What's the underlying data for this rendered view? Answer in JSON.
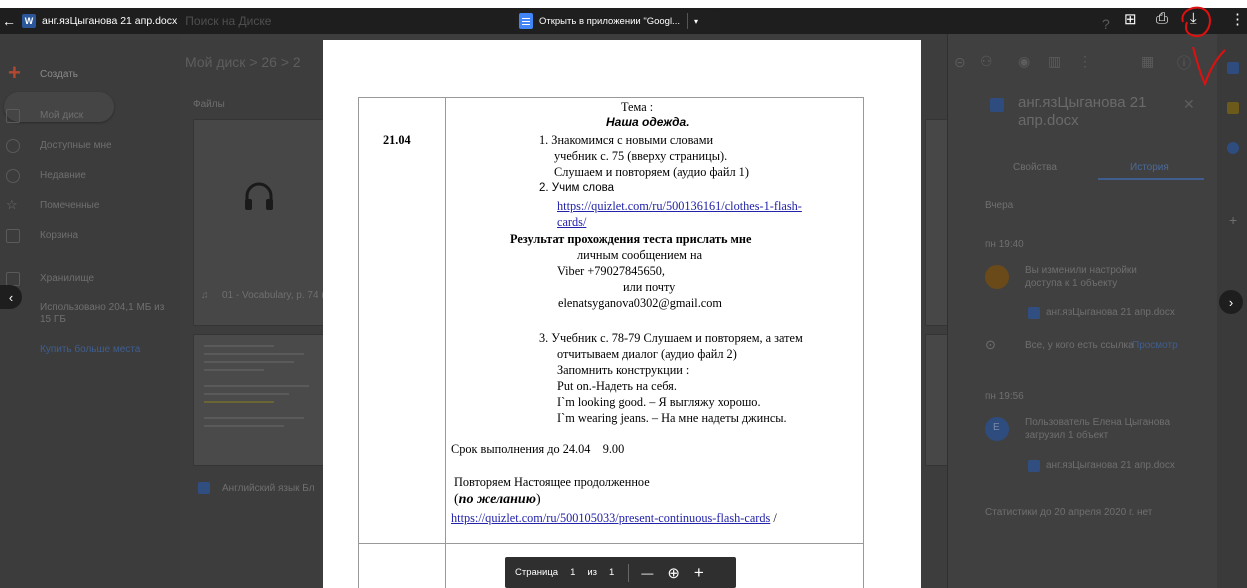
{
  "viewer": {
    "file_name": "анг.язЦыганова 21 апр.docx",
    "word_badge": "W",
    "search_placeholder": "Поиск на Диске",
    "open_button_label": "Открыть в приложении \"Googl...",
    "open_caret": "▾"
  },
  "drive_background": {
    "create_label": "Создать",
    "breadcrumb": "Мой диск > 26 > 2",
    "files_heading": "Файлы",
    "sidebar_items": [
      "Мой диск",
      "Доступные мне",
      "Недавние",
      "Помеченные",
      "Корзина"
    ],
    "storage_label": "Хранилище",
    "storage_usage": "Использовано 204,1 МБ из 15 ГБ",
    "buy_storage": "Купить больше места",
    "file_card_1": "01 - Vocabulary, p. 74 (",
    "file_card_2": "Английский язык Бл",
    "details": {
      "title": "анг.язЦыганова 21 апр.docx",
      "tabs": [
        "Свойства",
        "История"
      ],
      "yesterday": "Вчера",
      "time_1": "пн 19:40",
      "entry_1_text": "Вы изменили настройки доступа к 1 объекту",
      "entry_1_file": "анг.язЦыганова 21 апр.docx",
      "entry_1_access": "Все, у кого есть ссылка",
      "entry_1_access_role": "Просмотр",
      "time_2": "пн 19:56",
      "entry_2_text": "Пользователь Елена Цыганова загрузил 1 объект",
      "entry_2_file": "анг.язЦыганова 21 апр.docx",
      "footer": "Статистики до 20 апреля 2020 г. нет",
      "avatar_letter": "Е"
    }
  },
  "document": {
    "date": "21.04",
    "topic_label": "Тема :",
    "topic_title": "Наша одежда.",
    "item1_line1": "1.  Знакомимся с новыми словами",
    "item1_line2": "учебник с. 75 (вверху страницы).",
    "item1_line3": "Слушаем и повторяем (аудио файл 1)",
    "item2_line1": "2.  Учим слова",
    "item2_link_line1": "https://quizlet.com/ru/500136161/clothes-1-flash-",
    "item2_link_line2": "cards/",
    "result_bold": "Результат прохождения теста прислать мне",
    "result_line2": "личным сообщением на",
    "result_line3": "Viber +79027845650,",
    "result_line4": "или  почту",
    "result_line5": "elenatsyganova0302@gmail.com",
    "item3_line1": "3.  Учебник с. 78-79 Слушаем и повторяем, а затем",
    "item3_line2": "отчитываем диалог (аудио файл 2)",
    "item3_line3": "Запомнить конструкции :",
    "item3_line4": "Put on.-Надеть на себя.",
    "item3_line5": "I`m looking good. – Я выгляжу хорошо.",
    "item3_line6": "I`m wearing jeans. – На мне надеты джинсы.",
    "deadline": "Срок выполнения до 24.04    9.00",
    "repeat": "Повторяем Настоящее продолженное",
    "optional_open": "(",
    "optional": "по желанию",
    "optional_close": ")",
    "link2": "https://quizlet.com/ru/500105033/present-continuous-flash-cards",
    "link2_suffix": " /"
  },
  "page_control": {
    "page_label": "Страница",
    "current_page": "1",
    "of_label": "из",
    "total_pages": "1",
    "zoom_out": "—",
    "zoom_in": "+"
  },
  "icons": {
    "back": "←",
    "add_comment": "⊞",
    "print": "⎙",
    "download": "⤓",
    "more": "⋮",
    "prev": "‹",
    "next": "›",
    "search_zoom": "⊕"
  }
}
